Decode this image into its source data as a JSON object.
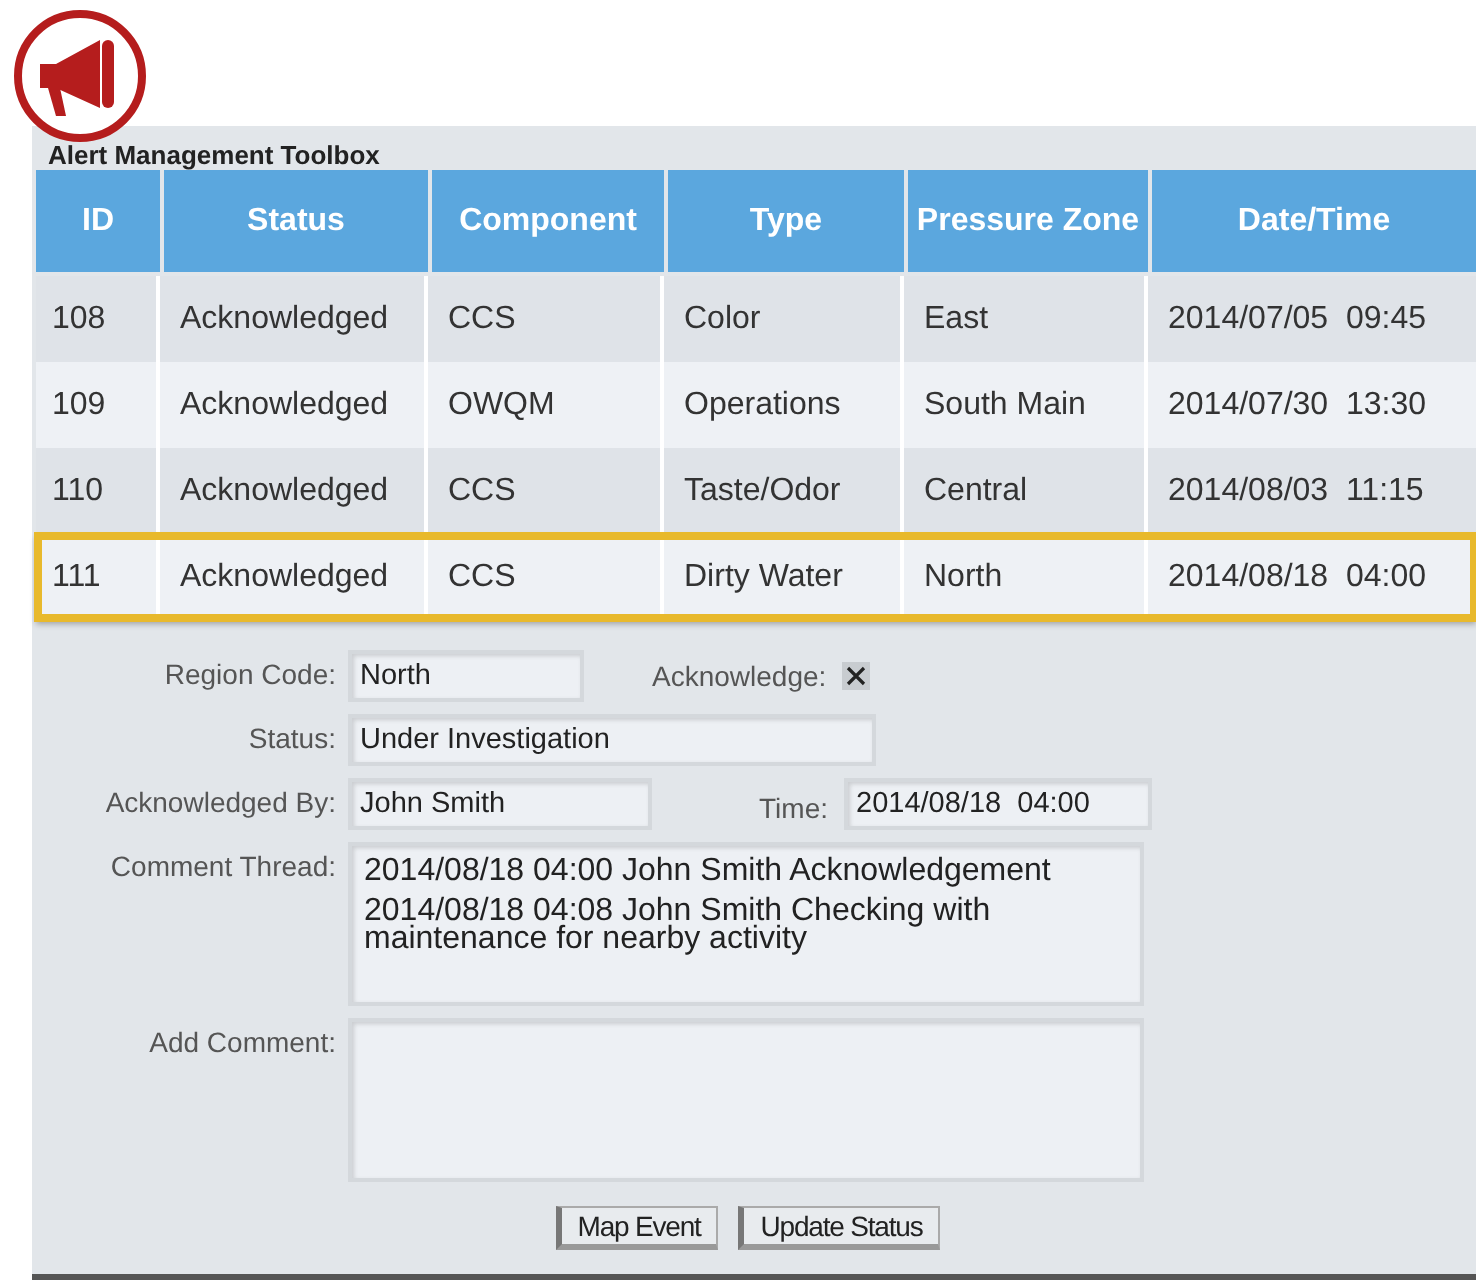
{
  "toolbox": {
    "title": "Alert Management Toolbox"
  },
  "table": {
    "columns": [
      "ID",
      "Status",
      "Component",
      "Type",
      "Pressure Zone",
      "Date/Time"
    ],
    "rows": [
      {
        "cells": [
          "108",
          "Acknowledged",
          "CCS",
          "Color",
          "East",
          "2014/07/05  09:45"
        ],
        "selected": false
      },
      {
        "cells": [
          "109",
          "Acknowledged",
          "OWQM",
          "Operations",
          "South Main",
          "2014/07/30  13:30"
        ],
        "selected": false
      },
      {
        "cells": [
          "110",
          "Acknowledged",
          "CCS",
          "Taste/Odor",
          "Central",
          "2014/08/03  11:15"
        ],
        "selected": false
      },
      {
        "cells": [
          "111",
          "Acknowledged",
          "CCS",
          "Dirty Water",
          "North",
          "2014/08/18  04:00"
        ],
        "selected": true
      }
    ]
  },
  "details": {
    "region_code": {
      "label": "Region Code:",
      "value": "North"
    },
    "acknowledge": {
      "label": "Acknowledge:",
      "checked": true
    },
    "status": {
      "label": "Status:",
      "value": "Under Investigation"
    },
    "acknowledged_by": {
      "label": "Acknowledged By:",
      "value": "John Smith"
    },
    "time": {
      "label": "Time:",
      "value": "2014/08/18  04:00"
    },
    "comment_thread": {
      "label": "Comment Thread:",
      "comments": [
        "2014/08/18  04:00  John Smith Acknowledgement",
        "2014/08/18  04:08  John Smith Checking with maintenance for nearby activity"
      ]
    },
    "add_comment": {
      "label": "Add Comment:"
    }
  },
  "buttons": [
    "Map Event",
    "Update Status"
  ]
}
